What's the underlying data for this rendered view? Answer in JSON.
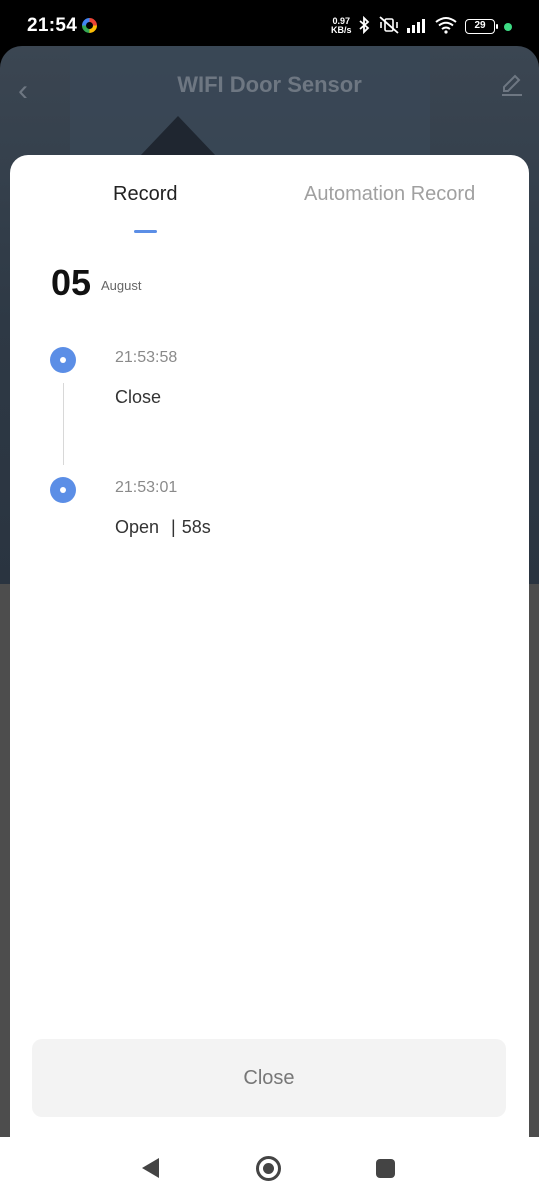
{
  "status_bar": {
    "time": "21:54",
    "net_speed_value": "0.97",
    "net_speed_unit": "KB/s",
    "battery": "29",
    "icons": [
      "google-icon",
      "bluetooth-icon",
      "vibrate-off-icon",
      "signal-icon",
      "wifi-icon",
      "battery-icon"
    ]
  },
  "background_page": {
    "title": "WIFI Door Sensor"
  },
  "tabs": {
    "record": "Record",
    "automation": "Automation Record",
    "active": "record"
  },
  "date": {
    "day": "05",
    "month": "August"
  },
  "records": [
    {
      "time": "21:53:58",
      "event": "Close",
      "duration": ""
    },
    {
      "time": "21:53:01",
      "event": "Open",
      "duration": "58s"
    }
  ],
  "close_button": "Close",
  "colors": {
    "accent": "#5b8ee6",
    "sheet_bg": "#ffffff",
    "button_bg": "#f3f3f3"
  }
}
